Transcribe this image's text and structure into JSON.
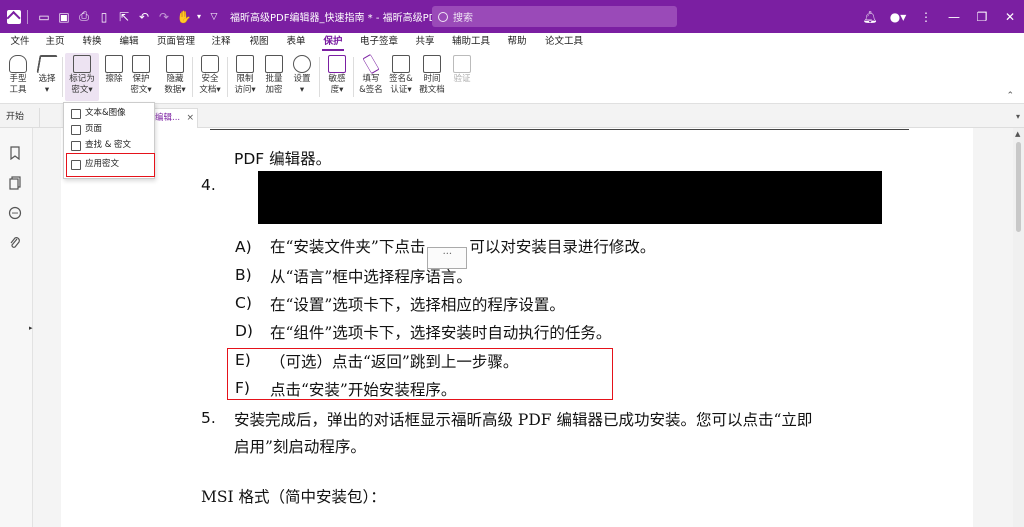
{
  "titlebar": {
    "title": "福昕高级PDF编辑器_快速指南 * - 福昕高级PDF编...",
    "search_placeholder": "搜索",
    "accent": "#7b1fa2"
  },
  "menu": {
    "items": [
      "文件",
      "主页",
      "转换",
      "编辑",
      "页面管理",
      "注释",
      "视图",
      "表单",
      "保护",
      "电子签章",
      "共享",
      "辅助工具",
      "帮助",
      "论文工具"
    ],
    "active": "保护"
  },
  "ribbon": {
    "buttons": [
      {
        "label": "手型\n工具",
        "icon": "hand-icon"
      },
      {
        "label": "选择\n▾",
        "icon": "cursor-icon"
      },
      {
        "label": "标记为\n密文▾",
        "icon": "mark-redaction-icon",
        "selected": true
      },
      {
        "label": "擦除",
        "icon": "eraser-icon"
      },
      {
        "label": "保护\n密文▾",
        "icon": "protect-redaction-icon"
      },
      {
        "label": "隐藏\n数据▾",
        "icon": "hide-data-icon"
      },
      {
        "label": "安全\n文档▾",
        "icon": "lock-icon"
      },
      {
        "label": "限制\n访问▾",
        "icon": "restrict-icon"
      },
      {
        "label": "批量\n加密",
        "icon": "batch-encrypt-icon"
      },
      {
        "label": "设置\n▾",
        "icon": "settings-lock-icon"
      },
      {
        "label": "敏感\n度▾",
        "icon": "sensitivity-icon"
      },
      {
        "label": "填写\n&签名",
        "icon": "pen-icon"
      },
      {
        "label": "签名&\n认证▾",
        "icon": "sign-icon"
      },
      {
        "label": "时间\n戳文档",
        "icon": "timestamp-icon"
      },
      {
        "label": "验证",
        "icon": "verify-icon",
        "disabled": true
      }
    ]
  },
  "tabs": {
    "start": "开始",
    "doc": "f编辑...",
    "close": "×"
  },
  "dropdown": {
    "items": [
      "文本&图像",
      "页面",
      "查找 & 密文",
      "应用密文"
    ],
    "highlighted": "应用密文"
  },
  "document": {
    "line_top": "PDF 编辑器。",
    "item4_num": "4.",
    "steps": [
      {
        "letter": "A)",
        "text_before": "在“安装文件夹”下点击",
        "inline_btn": "···",
        "text_after": "可以对安装目录进行修改。"
      },
      {
        "letter": "B)",
        "text": "从“语言”框中选择程序语言。"
      },
      {
        "letter": "C)",
        "text": "在“设置”选项卡下，选择相应的程序设置。"
      },
      {
        "letter": "D)",
        "text": "在“组件”选项卡下，选择安装时自动执行的任务。"
      },
      {
        "letter": "E)",
        "text": "（可选）点击“返回”跳到上一步骤。"
      },
      {
        "letter": "F)",
        "text": "点击“安装”开始安装程序。"
      }
    ],
    "item5_num": "5.",
    "item5_line1": "安装完成后，弹出的对话框显示福昕高级 PDF 编辑器已成功安装。您可以点击“立即",
    "item5_line2": "启用”刻启动程序。",
    "msi": "MSI 格式（简中安装包）："
  }
}
